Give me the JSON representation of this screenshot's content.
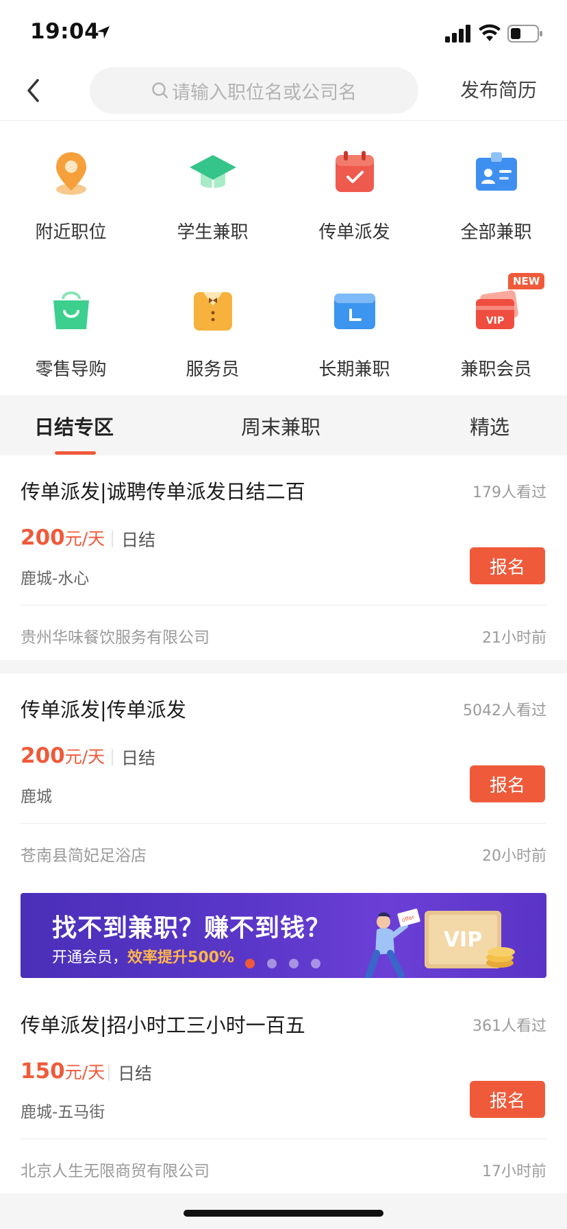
{
  "status_bar": {
    "time": "19:04"
  },
  "nav": {
    "search_placeholder": "请输入职位名或公司名",
    "publish_label": "发布简历"
  },
  "categories": [
    {
      "label": "附近职位",
      "icon": "location-pin-icon"
    },
    {
      "label": "学生兼职",
      "icon": "graduation-cap-icon"
    },
    {
      "label": "传单派发",
      "icon": "calendar-check-icon"
    },
    {
      "label": "全部兼职",
      "icon": "id-card-icon"
    },
    {
      "label": "零售导购",
      "icon": "shopping-bag-icon"
    },
    {
      "label": "服务员",
      "icon": "waiter-uniform-icon"
    },
    {
      "label": "长期兼职",
      "icon": "long-term-card-icon"
    },
    {
      "label": "兼职会员",
      "icon": "vip-card-icon",
      "badge": "NEW"
    }
  ],
  "tabs": [
    {
      "label": "日结专区",
      "active": true
    },
    {
      "label": "周末兼职",
      "active": false
    },
    {
      "label": "精选",
      "active": false
    }
  ],
  "jobs": [
    {
      "title": "传单派发|诚聘传单派发日结二百",
      "views": "179人看过",
      "salary": "200",
      "salary_unit": "元/天",
      "settle": "日结",
      "location": "鹿城-水心",
      "apply_label": "报名",
      "company": "贵州华味餐饮服务有限公司",
      "time": "21小时前"
    },
    {
      "title": "传单派发|传单派发",
      "views": "5042人看过",
      "salary": "200",
      "salary_unit": "元/天",
      "settle": "日结",
      "location": "鹿城",
      "apply_label": "报名",
      "company": "苍南县简妃足浴店",
      "time": "20小时前"
    },
    {
      "title": "传单派发|招小时工三小时一百五",
      "views": "361人看过",
      "salary": "150",
      "salary_unit": "元/天",
      "settle": "日结",
      "location": "鹿城-五马街",
      "apply_label": "报名",
      "company": "北京人生无限商贸有限公司",
      "time": "17小时前"
    }
  ],
  "banner": {
    "title": "找不到兼职？赚不到钱？",
    "sub_prefix": "开通会员，",
    "sub_highlight": "效率提升500%",
    "vip_text": "VIP",
    "offer_text": "offer",
    "dots_total": 4,
    "dots_active_index": 0
  },
  "colors": {
    "accent": "#ef5a3a",
    "banner_bg": "#5b37c9",
    "tab_bg": "#f5f5f5"
  }
}
